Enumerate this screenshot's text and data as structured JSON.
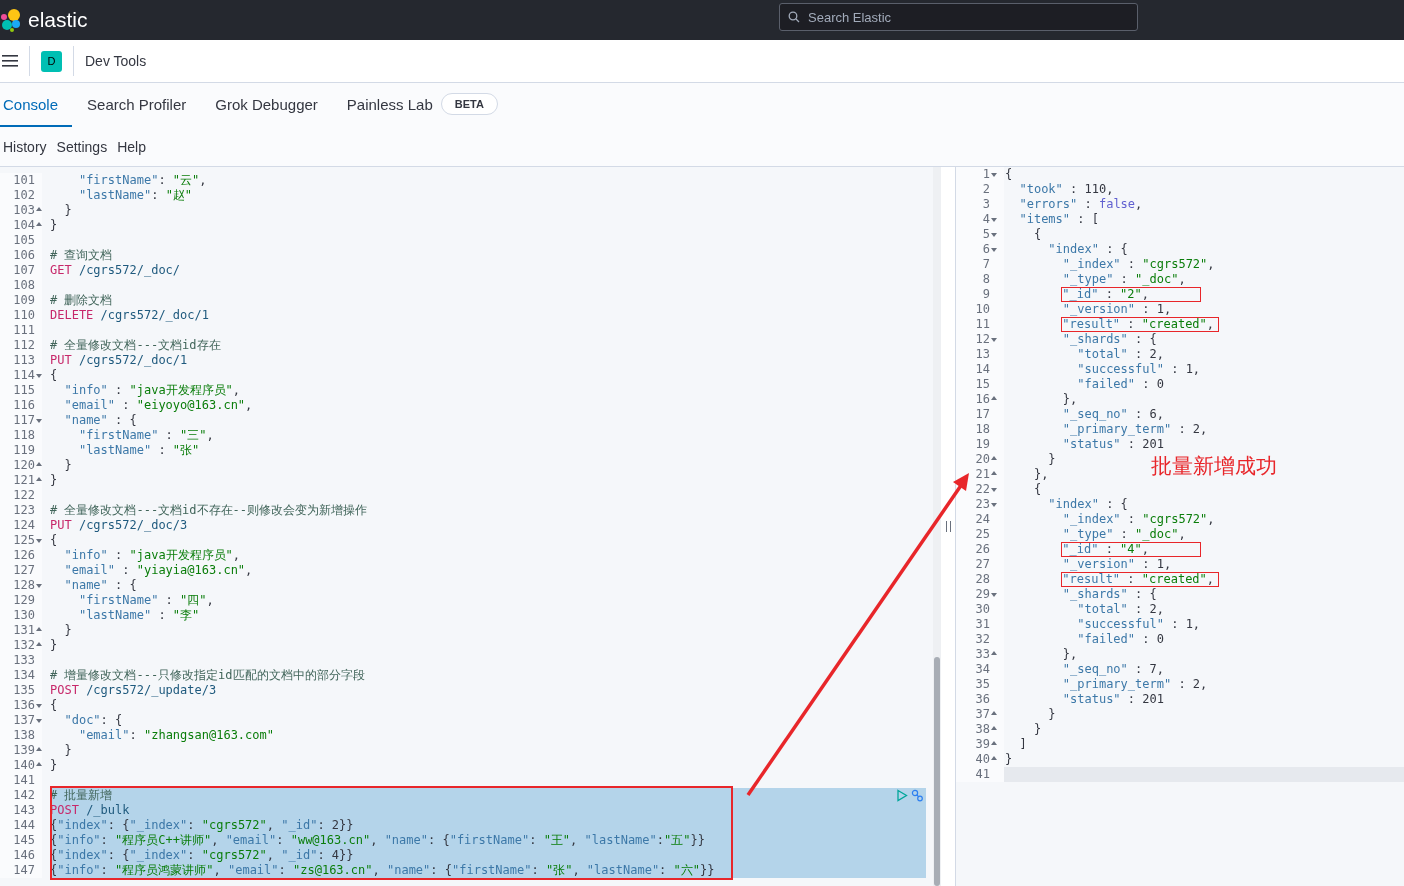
{
  "top_bar": {
    "logo": "elastic",
    "search": {
      "placeholder": "Search Elastic"
    }
  },
  "header": {
    "avatar": "D",
    "title": "Dev Tools"
  },
  "tabs": [
    {
      "label": "Console",
      "selected": true
    },
    {
      "label": "Search Profiler",
      "selected": false
    },
    {
      "label": "Grok Debugger",
      "selected": false
    },
    {
      "label": "Painless Lab",
      "selected": false,
      "badge": "BETA"
    }
  ],
  "subnav": [
    "History",
    "Settings",
    "Help"
  ],
  "request_pane": {
    "lines": [
      {
        "number": "101",
        "kind": "plain",
        "selected": false,
        "text": "    \"firstName\": \"云\","
      },
      {
        "number": "102",
        "kind": "plain",
        "selected": false,
        "text": "    \"lastName\": \"赵\""
      },
      {
        "number": "103",
        "kind": "close",
        "selected": false,
        "text": "  }"
      },
      {
        "number": "104",
        "kind": "close",
        "selected": false,
        "text": "}"
      },
      {
        "number": "105",
        "kind": "plain",
        "selected": false
      },
      {
        "number": "106",
        "kind": "plain",
        "selected": false,
        "text": "# 查询文档"
      },
      {
        "number": "107",
        "kind": "plain",
        "selected": false,
        "text": "GET /cgrs572/_doc/"
      },
      {
        "number": "108",
        "kind": "plain",
        "selected": false
      },
      {
        "number": "109",
        "kind": "plain",
        "selected": false,
        "text": "# 删除文档"
      },
      {
        "number": "110",
        "kind": "plain",
        "selected": false,
        "text": "DELETE /cgrs572/_doc/1"
      },
      {
        "number": "111",
        "kind": "plain",
        "selected": false
      },
      {
        "number": "112",
        "kind": "plain",
        "selected": false,
        "text": "# 全量修改文档---文档id存在"
      },
      {
        "number": "113",
        "kind": "plain",
        "selected": false,
        "text": "PUT /cgrs572/_doc/1"
      },
      {
        "number": "114",
        "kind": "open",
        "selected": false,
        "text": "{"
      },
      {
        "number": "115",
        "kind": "plain",
        "selected": false,
        "text": "  \"info\" : \"java开发程序员\","
      },
      {
        "number": "116",
        "kind": "plain",
        "selected": false,
        "text": "  \"email\" : \"eiyoyo@163.cn\","
      },
      {
        "number": "117",
        "kind": "open",
        "selected": false,
        "text": "  \"name\" : {"
      },
      {
        "number": "118",
        "kind": "plain",
        "selected": false,
        "text": "    \"firstName\" : \"三\","
      },
      {
        "number": "119",
        "kind": "plain",
        "selected": false,
        "text": "    \"lastName\" : \"张\""
      },
      {
        "number": "120",
        "kind": "close",
        "selected": false,
        "text": "  }"
      },
      {
        "number": "121",
        "kind": "close",
        "selected": false,
        "text": "}"
      },
      {
        "number": "122",
        "kind": "plain",
        "selected": false
      },
      {
        "number": "123",
        "kind": "plain",
        "selected": false,
        "text": "# 全量修改文档---文档id不存在--则修改会变为新增操作"
      },
      {
        "number": "124",
        "kind": "plain",
        "selected": false,
        "text": "PUT /cgrs572/_doc/3"
      },
      {
        "number": "125",
        "kind": "open",
        "selected": false,
        "text": "{"
      },
      {
        "number": "126",
        "kind": "plain",
        "selected": false,
        "text": "  \"info\" : \"java开发程序员\","
      },
      {
        "number": "127",
        "kind": "plain",
        "selected": false,
        "text": "  \"email\" : \"yiayia@163.cn\","
      },
      {
        "number": "128",
        "kind": "open",
        "selected": false,
        "text": "  \"name\" : {"
      },
      {
        "number": "129",
        "kind": "plain",
        "selected": false,
        "text": "    \"firstName\" : \"四\","
      },
      {
        "number": "130",
        "kind": "plain",
        "selected": false,
        "text": "    \"lastName\" : \"李\""
      },
      {
        "number": "131",
        "kind": "close",
        "selected": false,
        "text": "  }"
      },
      {
        "number": "132",
        "kind": "close",
        "selected": false,
        "text": "}"
      },
      {
        "number": "133",
        "kind": "plain",
        "selected": false
      },
      {
        "number": "134",
        "kind": "plain",
        "selected": false,
        "text": "# 增量修改文档---只修改指定id匹配的文档中的部分字段"
      },
      {
        "number": "135",
        "kind": "plain",
        "selected": false,
        "text": "POST /cgrs572/_update/3"
      },
      {
        "number": "136",
        "kind": "open",
        "selected": false,
        "text": "{"
      },
      {
        "number": "137",
        "kind": "open",
        "selected": false,
        "text": "  \"doc\": {"
      },
      {
        "number": "138",
        "kind": "plain",
        "selected": false,
        "text": "    \"email\": \"zhangsan@163.com\""
      },
      {
        "number": "139",
        "kind": "close",
        "selected": false,
        "text": "  }"
      },
      {
        "number": "140",
        "kind": "close",
        "selected": false,
        "text": "}"
      },
      {
        "number": "141",
        "kind": "plain",
        "selected": false
      },
      {
        "number": "142",
        "kind": "plain",
        "selected": true,
        "text": "# 批量新增"
      },
      {
        "number": "143",
        "kind": "plain",
        "selected": true,
        "text": "POST /_bulk"
      },
      {
        "number": "144",
        "kind": "plain",
        "selected": true,
        "text": "{\"index\": {\"_index\": \"cgrs572\", \"_id\": 2}}"
      },
      {
        "number": "145",
        "kind": "plain",
        "selected": true,
        "text": "{\"info\": \"程序员C++讲师\", \"email\": \"ww@163.cn\", \"name\": {\"firstName\": \"王\", \"lastName\":\"五\"}}"
      },
      {
        "number": "146",
        "kind": "plain",
        "selected": true,
        "text": "{\"index\": {\"_index\": \"cgrs572\", \"_id\": 4}}"
      },
      {
        "number": "147",
        "kind": "plain",
        "selected": true,
        "text": "{\"info\": \"程序员鸿蒙讲师\", \"email\": \"zs@163.cn\", \"name\": {\"firstName\": \"张\", \"lastName\": \"六\"}}"
      }
    ]
  },
  "response_pane": {
    "lines": [
      {
        "number": "1",
        "kind": "open",
        "boxed": false,
        "text": "{"
      },
      {
        "number": "2",
        "kind": "plain",
        "boxed": false,
        "text": "  \"took\" : 110,"
      },
      {
        "number": "3",
        "kind": "plain",
        "boxed": false,
        "text": "  \"errors\" : false,"
      },
      {
        "number": "4",
        "kind": "open",
        "boxed": false,
        "text": "  \"items\" : ["
      },
      {
        "number": "5",
        "kind": "open",
        "boxed": false,
        "text": "    {"
      },
      {
        "number": "6",
        "kind": "open",
        "boxed": false,
        "text": "      \"index\" : {"
      },
      {
        "number": "7",
        "kind": "plain",
        "boxed": false,
        "text": "        \"_index\" : \"cgrs572\","
      },
      {
        "number": "8",
        "kind": "plain",
        "boxed": false,
        "text": "        \"_type\" : \"_doc\","
      },
      {
        "number": "9",
        "kind": "plain",
        "boxed": true,
        "text": "        \"_id\" : \"2\","
      },
      {
        "number": "10",
        "kind": "plain",
        "boxed": false,
        "text": "        \"_version\" : 1,"
      },
      {
        "number": "11",
        "kind": "plain",
        "boxed": true,
        "text": "        \"result\" : \"created\","
      },
      {
        "number": "12",
        "kind": "open",
        "boxed": false,
        "text": "        \"_shards\" : {"
      },
      {
        "number": "13",
        "kind": "plain",
        "boxed": false,
        "text": "          \"total\" : 2,"
      },
      {
        "number": "14",
        "kind": "plain",
        "boxed": false,
        "text": "          \"successful\" : 1,"
      },
      {
        "number": "15",
        "kind": "plain",
        "boxed": false,
        "text": "          \"failed\" : 0"
      },
      {
        "number": "16",
        "kind": "close",
        "boxed": false,
        "text": "        },"
      },
      {
        "number": "17",
        "kind": "plain",
        "boxed": false,
        "text": "        \"_seq_no\" : 6,"
      },
      {
        "number": "18",
        "kind": "plain",
        "boxed": false,
        "text": "        \"_primary_term\" : 2,"
      },
      {
        "number": "19",
        "kind": "plain",
        "boxed": false,
        "text": "        \"status\" : 201"
      },
      {
        "number": "20",
        "kind": "close",
        "boxed": false,
        "text": "      }"
      },
      {
        "number": "21",
        "kind": "close",
        "boxed": false,
        "text": "    },"
      },
      {
        "number": "22",
        "kind": "open",
        "boxed": false,
        "text": "    {"
      },
      {
        "number": "23",
        "kind": "open",
        "boxed": false,
        "text": "      \"index\" : {"
      },
      {
        "number": "24",
        "kind": "plain",
        "boxed": false,
        "text": "        \"_index\" : \"cgrs572\","
      },
      {
        "number": "25",
        "kind": "plain",
        "boxed": false,
        "text": "        \"_type\" : \"_doc\","
      },
      {
        "number": "26",
        "kind": "plain",
        "boxed": true,
        "text": "        \"_id\" : \"4\","
      },
      {
        "number": "27",
        "kind": "plain",
        "boxed": false,
        "text": "        \"_version\" : 1,"
      },
      {
        "number": "28",
        "kind": "plain",
        "boxed": true,
        "text": "        \"result\" : \"created\","
      },
      {
        "number": "29",
        "kind": "open",
        "boxed": false,
        "text": "        \"_shards\" : {"
      },
      {
        "number": "30",
        "kind": "plain",
        "boxed": false,
        "text": "          \"total\" : 2,"
      },
      {
        "number": "31",
        "kind": "plain",
        "boxed": false,
        "text": "          \"successful\" : 1,"
      },
      {
        "number": "32",
        "kind": "plain",
        "boxed": false,
        "text": "          \"failed\" : 0"
      },
      {
        "number": "33",
        "kind": "close",
        "boxed": false,
        "text": "        },"
      },
      {
        "number": "34",
        "kind": "plain",
        "boxed": false,
        "text": "        \"_seq_no\" : 7,"
      },
      {
        "number": "35",
        "kind": "plain",
        "boxed": false,
        "text": "        \"_primary_term\" : 2,"
      },
      {
        "number": "36",
        "kind": "plain",
        "boxed": false,
        "text": "        \"status\" : 201"
      },
      {
        "number": "37",
        "kind": "close",
        "boxed": false,
        "text": "      }"
      },
      {
        "number": "38",
        "kind": "close",
        "boxed": false,
        "text": "    }"
      },
      {
        "number": "39",
        "kind": "close",
        "boxed": false,
        "text": "  ]"
      },
      {
        "number": "40",
        "kind": "close",
        "boxed": false,
        "text": "}"
      },
      {
        "number": "41",
        "kind": "plain",
        "boxed": false
      }
    ]
  },
  "annotation": {
    "text": "批量新增成功"
  }
}
